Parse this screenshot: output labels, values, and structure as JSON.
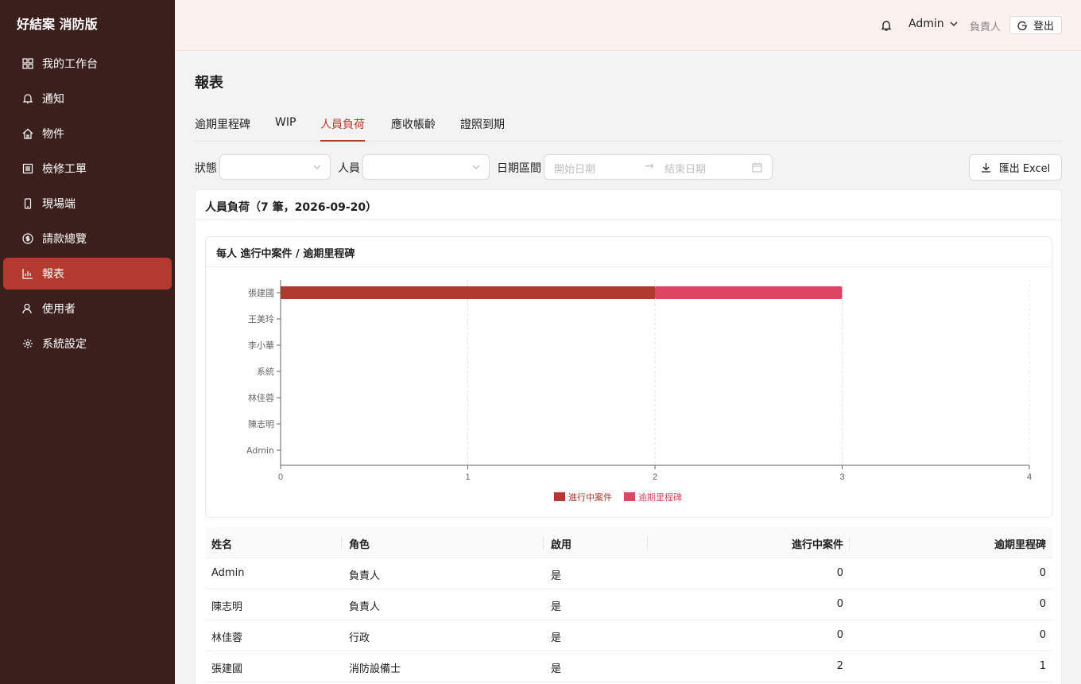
{
  "app": {
    "brand": "好結案 消防版"
  },
  "sidebar": {
    "items": [
      {
        "label": "我的工作台",
        "icon": "dashboard-icon",
        "active": false
      },
      {
        "label": "通知",
        "icon": "bell-icon",
        "active": false
      },
      {
        "label": "物件",
        "icon": "home-icon",
        "active": false
      },
      {
        "label": "檢修工單",
        "icon": "list-icon",
        "active": false
      },
      {
        "label": "現場端",
        "icon": "mobile-icon",
        "active": false
      },
      {
        "label": "請款總覽",
        "icon": "dollar-icon",
        "active": false
      },
      {
        "label": "報表",
        "icon": "bar-chart-icon",
        "active": true
      },
      {
        "label": "使用者",
        "icon": "user-icon",
        "active": false
      },
      {
        "label": "系統設定",
        "icon": "gear-icon",
        "active": false
      }
    ]
  },
  "header": {
    "user": "Admin",
    "role": "負責人",
    "logout": "登出"
  },
  "page": {
    "title": "報表",
    "tabs": [
      "逾期里程碑",
      "WIP",
      "人員負荷",
      "應收帳齡",
      "證照到期"
    ],
    "active_tab": "人員負荷"
  },
  "filters": {
    "status_label": "狀態",
    "person_label": "人員",
    "date_label": "日期區間",
    "start_placeholder": "開始日期",
    "end_placeholder": "結束日期",
    "export_label": "匯出 Excel"
  },
  "report": {
    "title": "人員負荷（7 筆，2026-09-20）",
    "chart_title": "每人 進行中案件 / 逾期里程碑"
  },
  "chart_data": {
    "type": "bar",
    "orientation": "horizontal",
    "stacked": true,
    "categories": [
      "張建國",
      "王美玲",
      "李小華",
      "系統",
      "林佳蓉",
      "陳志明",
      "Admin"
    ],
    "series": [
      {
        "name": "進行中案件",
        "values": [
          2,
          0,
          0,
          0,
          0,
          0,
          0
        ],
        "color": "#b03a2e"
      },
      {
        "name": "逾期里程碑",
        "values": [
          1,
          0,
          0,
          0,
          0,
          0,
          0
        ],
        "color": "#dc4662"
      }
    ],
    "xlim": [
      0,
      4
    ],
    "xticks": [
      "0",
      "1",
      "2",
      "3",
      "4"
    ],
    "grid": true,
    "legend": "bottom"
  },
  "table": {
    "headers": [
      "姓名",
      "角色",
      "啟用",
      "進行中案件",
      "逾期里程碑"
    ],
    "rows": [
      [
        "Admin",
        "負責人",
        "是",
        "0",
        "0"
      ],
      [
        "陳志明",
        "負責人",
        "是",
        "0",
        "0"
      ],
      [
        "林佳蓉",
        "行政",
        "是",
        "0",
        "0"
      ],
      [
        "張建國",
        "消防設備士",
        "是",
        "2",
        "1"
      ]
    ]
  },
  "colors": {
    "sidebar_bg": "#3b1f1d",
    "accent": "#b43a2f",
    "header_bg": "#fbf1ef"
  }
}
